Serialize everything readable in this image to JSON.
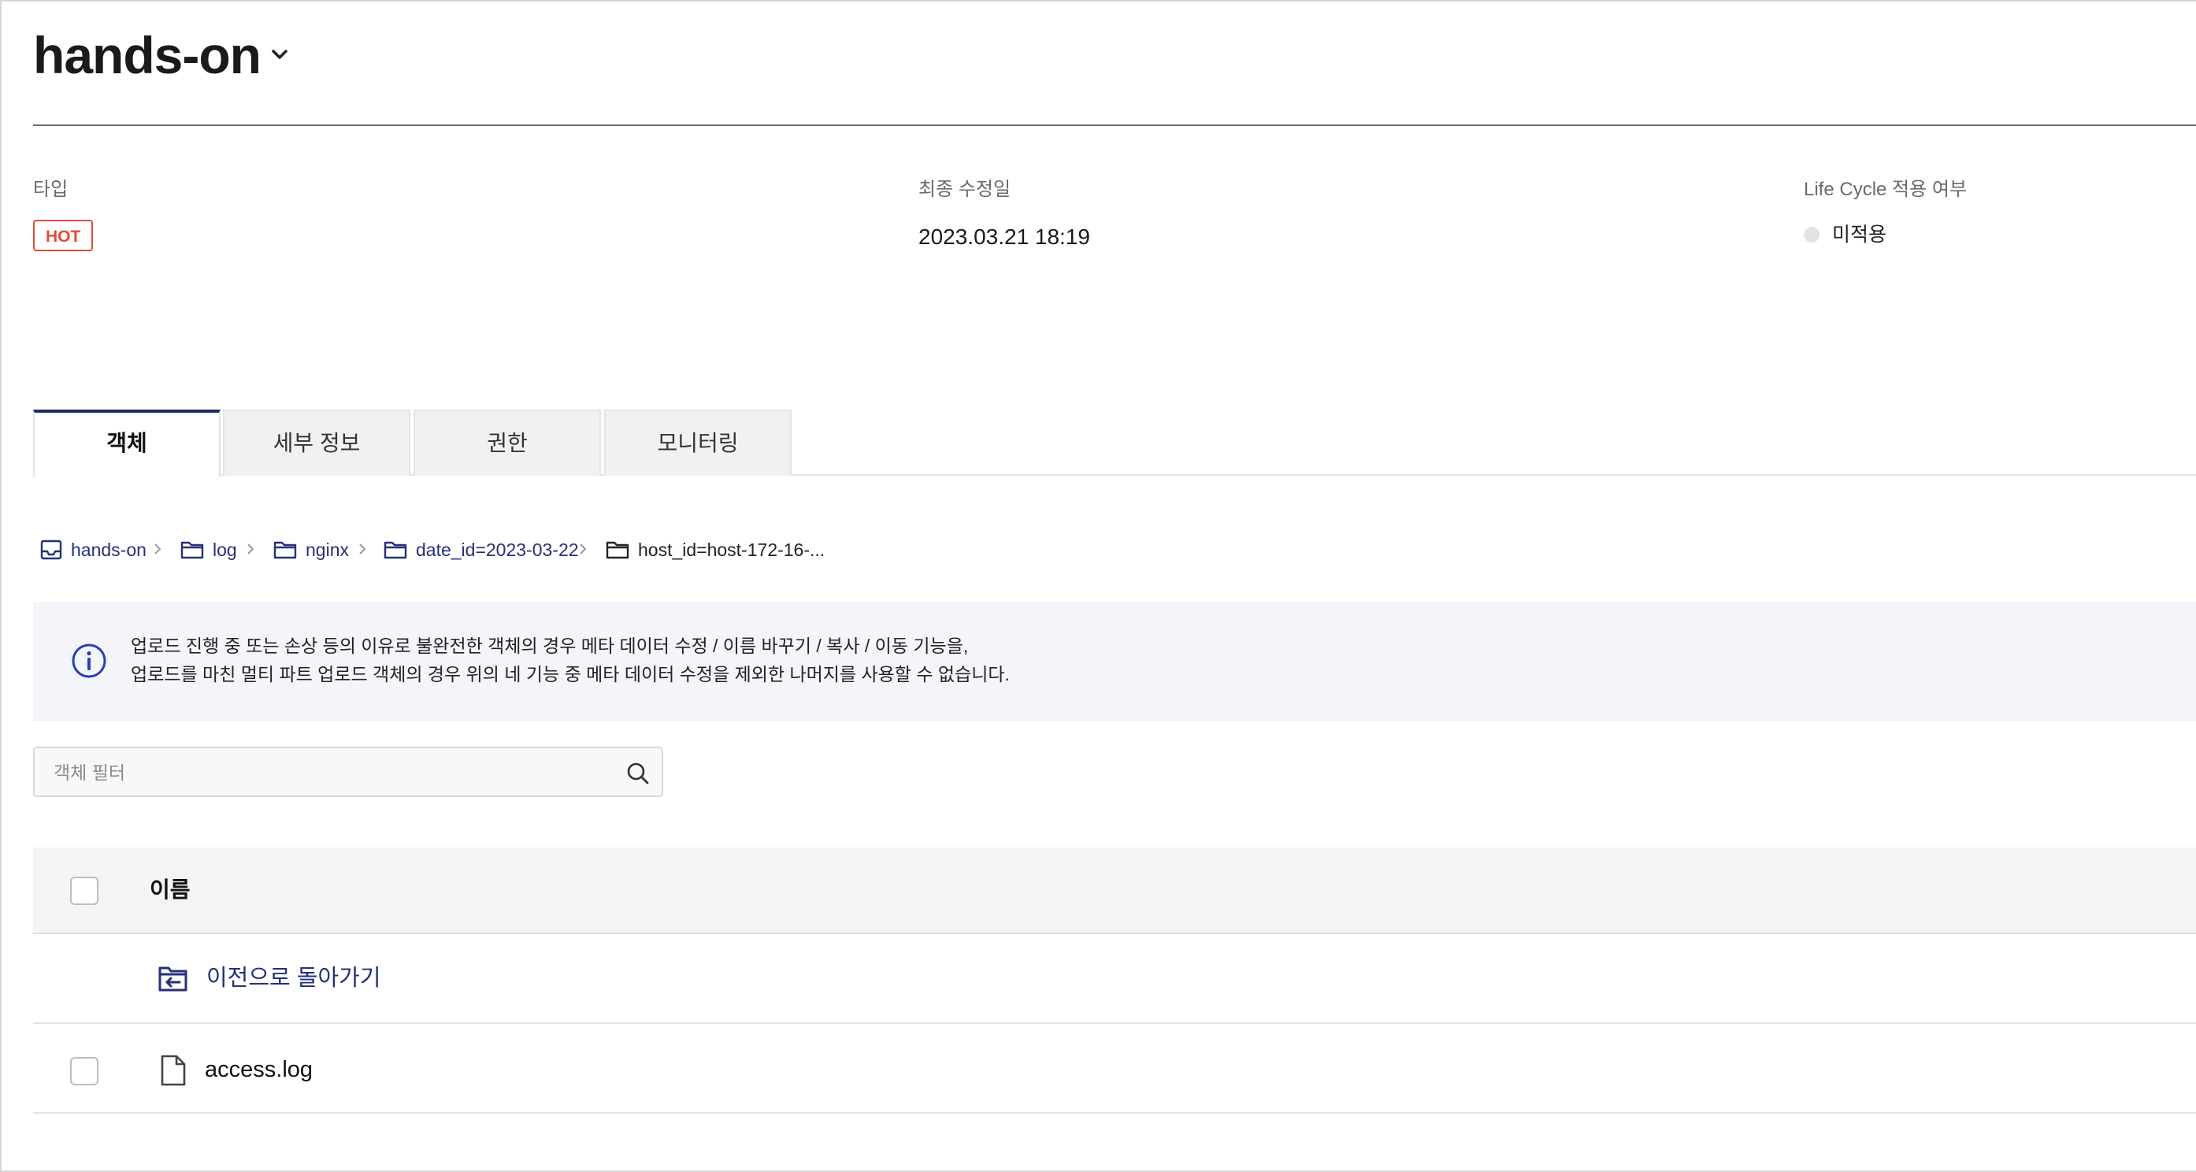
{
  "header": {
    "title": "hands-on"
  },
  "meta": {
    "type_label": "타입",
    "type_badge": "HOT",
    "modified_label": "최종 수정일",
    "modified_value": "2023.03.21 18:19",
    "lifecycle_label": "Life Cycle 적용 여부",
    "lifecycle_value": "미적용"
  },
  "tabs": [
    {
      "label": "객체",
      "active": true
    },
    {
      "label": "세부 정보",
      "active": false
    },
    {
      "label": "권한",
      "active": false
    },
    {
      "label": "모니터링",
      "active": false
    }
  ],
  "breadcrumb": [
    {
      "label": "hands-on",
      "icon": "bucket-icon"
    },
    {
      "label": "log",
      "icon": "folder-icon"
    },
    {
      "label": "nginx",
      "icon": "folder-icon"
    },
    {
      "label": "date_id=2023-03-22",
      "icon": "folder-icon"
    },
    {
      "label": "host_id=host-172-16-...",
      "icon": "folder-icon"
    }
  ],
  "notice": {
    "line1": "업로드 진행 중 또는 손상 등의 이유로 불완전한 객체의 경우 메타 데이터 수정 / 이름 바꾸기 / 복사 / 이동 기능을,",
    "line2": "업로드를 마친 멀티 파트 업로드 객체의 경우 위의 네 기능 중 메타 데이터 수정을 제외한 나머지를 사용할 수 없습니다."
  },
  "filter": {
    "placeholder": "객체 필터",
    "value": ""
  },
  "table": {
    "header_name": "이름",
    "back_label": "이전으로 돌아가기",
    "rows": [
      {
        "name": "access.log",
        "icon": "file-icon"
      }
    ]
  },
  "colors": {
    "accent": "#25307a",
    "badge": "#e24b3b",
    "tab_active_border": "#1d2a5a"
  }
}
